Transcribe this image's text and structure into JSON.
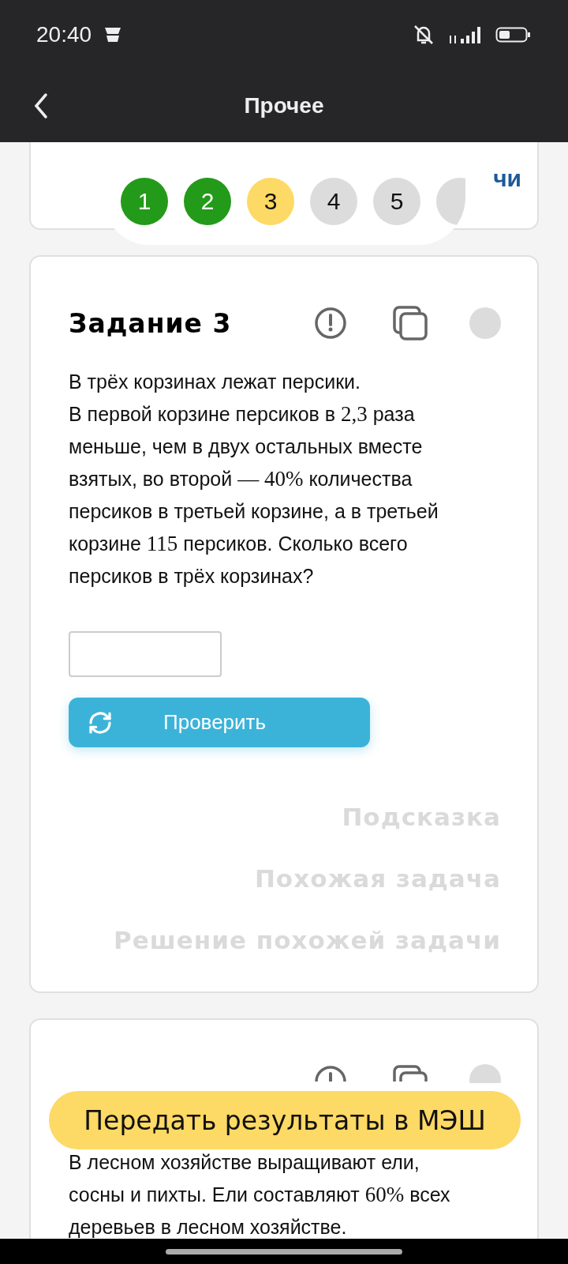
{
  "status_bar": {
    "time": "20:40"
  },
  "app_bar": {
    "title": "Прочее"
  },
  "previous_card": {
    "link_fragment": "чи"
  },
  "pagination": [
    {
      "label": "1",
      "done": true,
      "selected": false
    },
    {
      "label": "2",
      "done": true,
      "selected": false
    },
    {
      "label": "3",
      "done": false,
      "selected": true
    },
    {
      "label": "4",
      "done": false,
      "selected": false
    },
    {
      "label": "5",
      "done": false,
      "selected": false
    },
    {
      "done": false,
      "selected": false
    }
  ],
  "tasks": [
    {
      "title": "Задание 3",
      "paragraphs": [
        [
          {
            "kind": "text",
            "text": "В трёх корзинах лежат персики."
          }
        ],
        [
          {
            "kind": "text",
            "text": "В первой корзине персиков в "
          },
          {
            "kind": "math",
            "text": "2,3"
          },
          {
            "kind": "text",
            "text": " раза меньше, чем в двух остальных вместе взятых, во второй "
          },
          {
            "kind": "math",
            "text": "— 40%"
          },
          {
            "kind": "text",
            "text": " количества персиков в третьей корзине, а в третьей корзине "
          },
          {
            "kind": "math",
            "text": "115"
          },
          {
            "kind": "text",
            "text": " персиков. Сколько всего персиков в трёх корзинах?"
          }
        ]
      ],
      "check_button": "Проверить",
      "links": [
        "Подсказка",
        "Похожая задача",
        "Решение похожей задачи"
      ]
    },
    {
      "paragraphs": [
        [
          {
            "kind": "text",
            "text": "В лесном хозяйстве выращивают ели, сосны и пихты. Ели составляют "
          },
          {
            "kind": "math",
            "text": "60%"
          },
          {
            "kind": "text",
            "text": " всех деревьев в лесном хозяйстве."
          }
        ]
      ]
    }
  ],
  "submit_button": "Передать результаты в МЭШ"
}
